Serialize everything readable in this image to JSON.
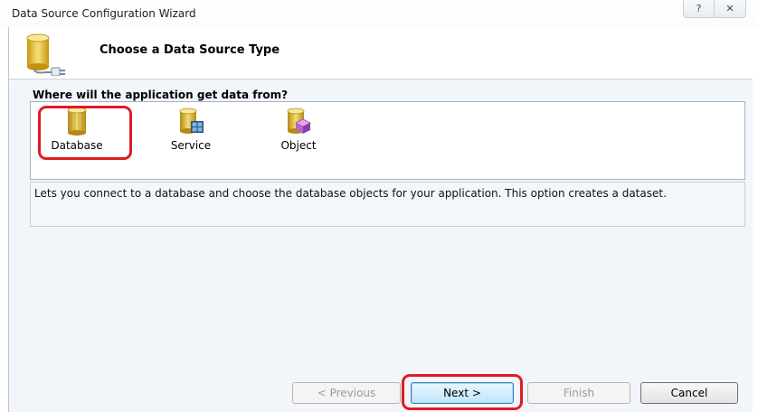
{
  "window": {
    "title": "Data Source Configuration Wizard",
    "help_glyph": "?",
    "close_glyph": "✕"
  },
  "header": {
    "title": "Choose a Data Source Type",
    "icon": "database-plug-icon"
  },
  "main": {
    "question": "Where will the application get data from?",
    "choices": [
      {
        "label": "Database",
        "icon": "database-icon",
        "selected": true
      },
      {
        "label": "Service",
        "icon": "service-icon",
        "selected": false
      },
      {
        "label": "Object",
        "icon": "object-icon",
        "selected": false
      }
    ],
    "description": "Lets you connect to a database and choose the database objects for your application. This option creates a dataset."
  },
  "buttons": {
    "previous": "< Previous",
    "next": "Next >",
    "finish": "Finish",
    "cancel": "Cancel"
  },
  "colors": {
    "highlight": "#e01b24",
    "panel_background": "#f2f5f9",
    "database_yellow": "#e8c23a"
  }
}
